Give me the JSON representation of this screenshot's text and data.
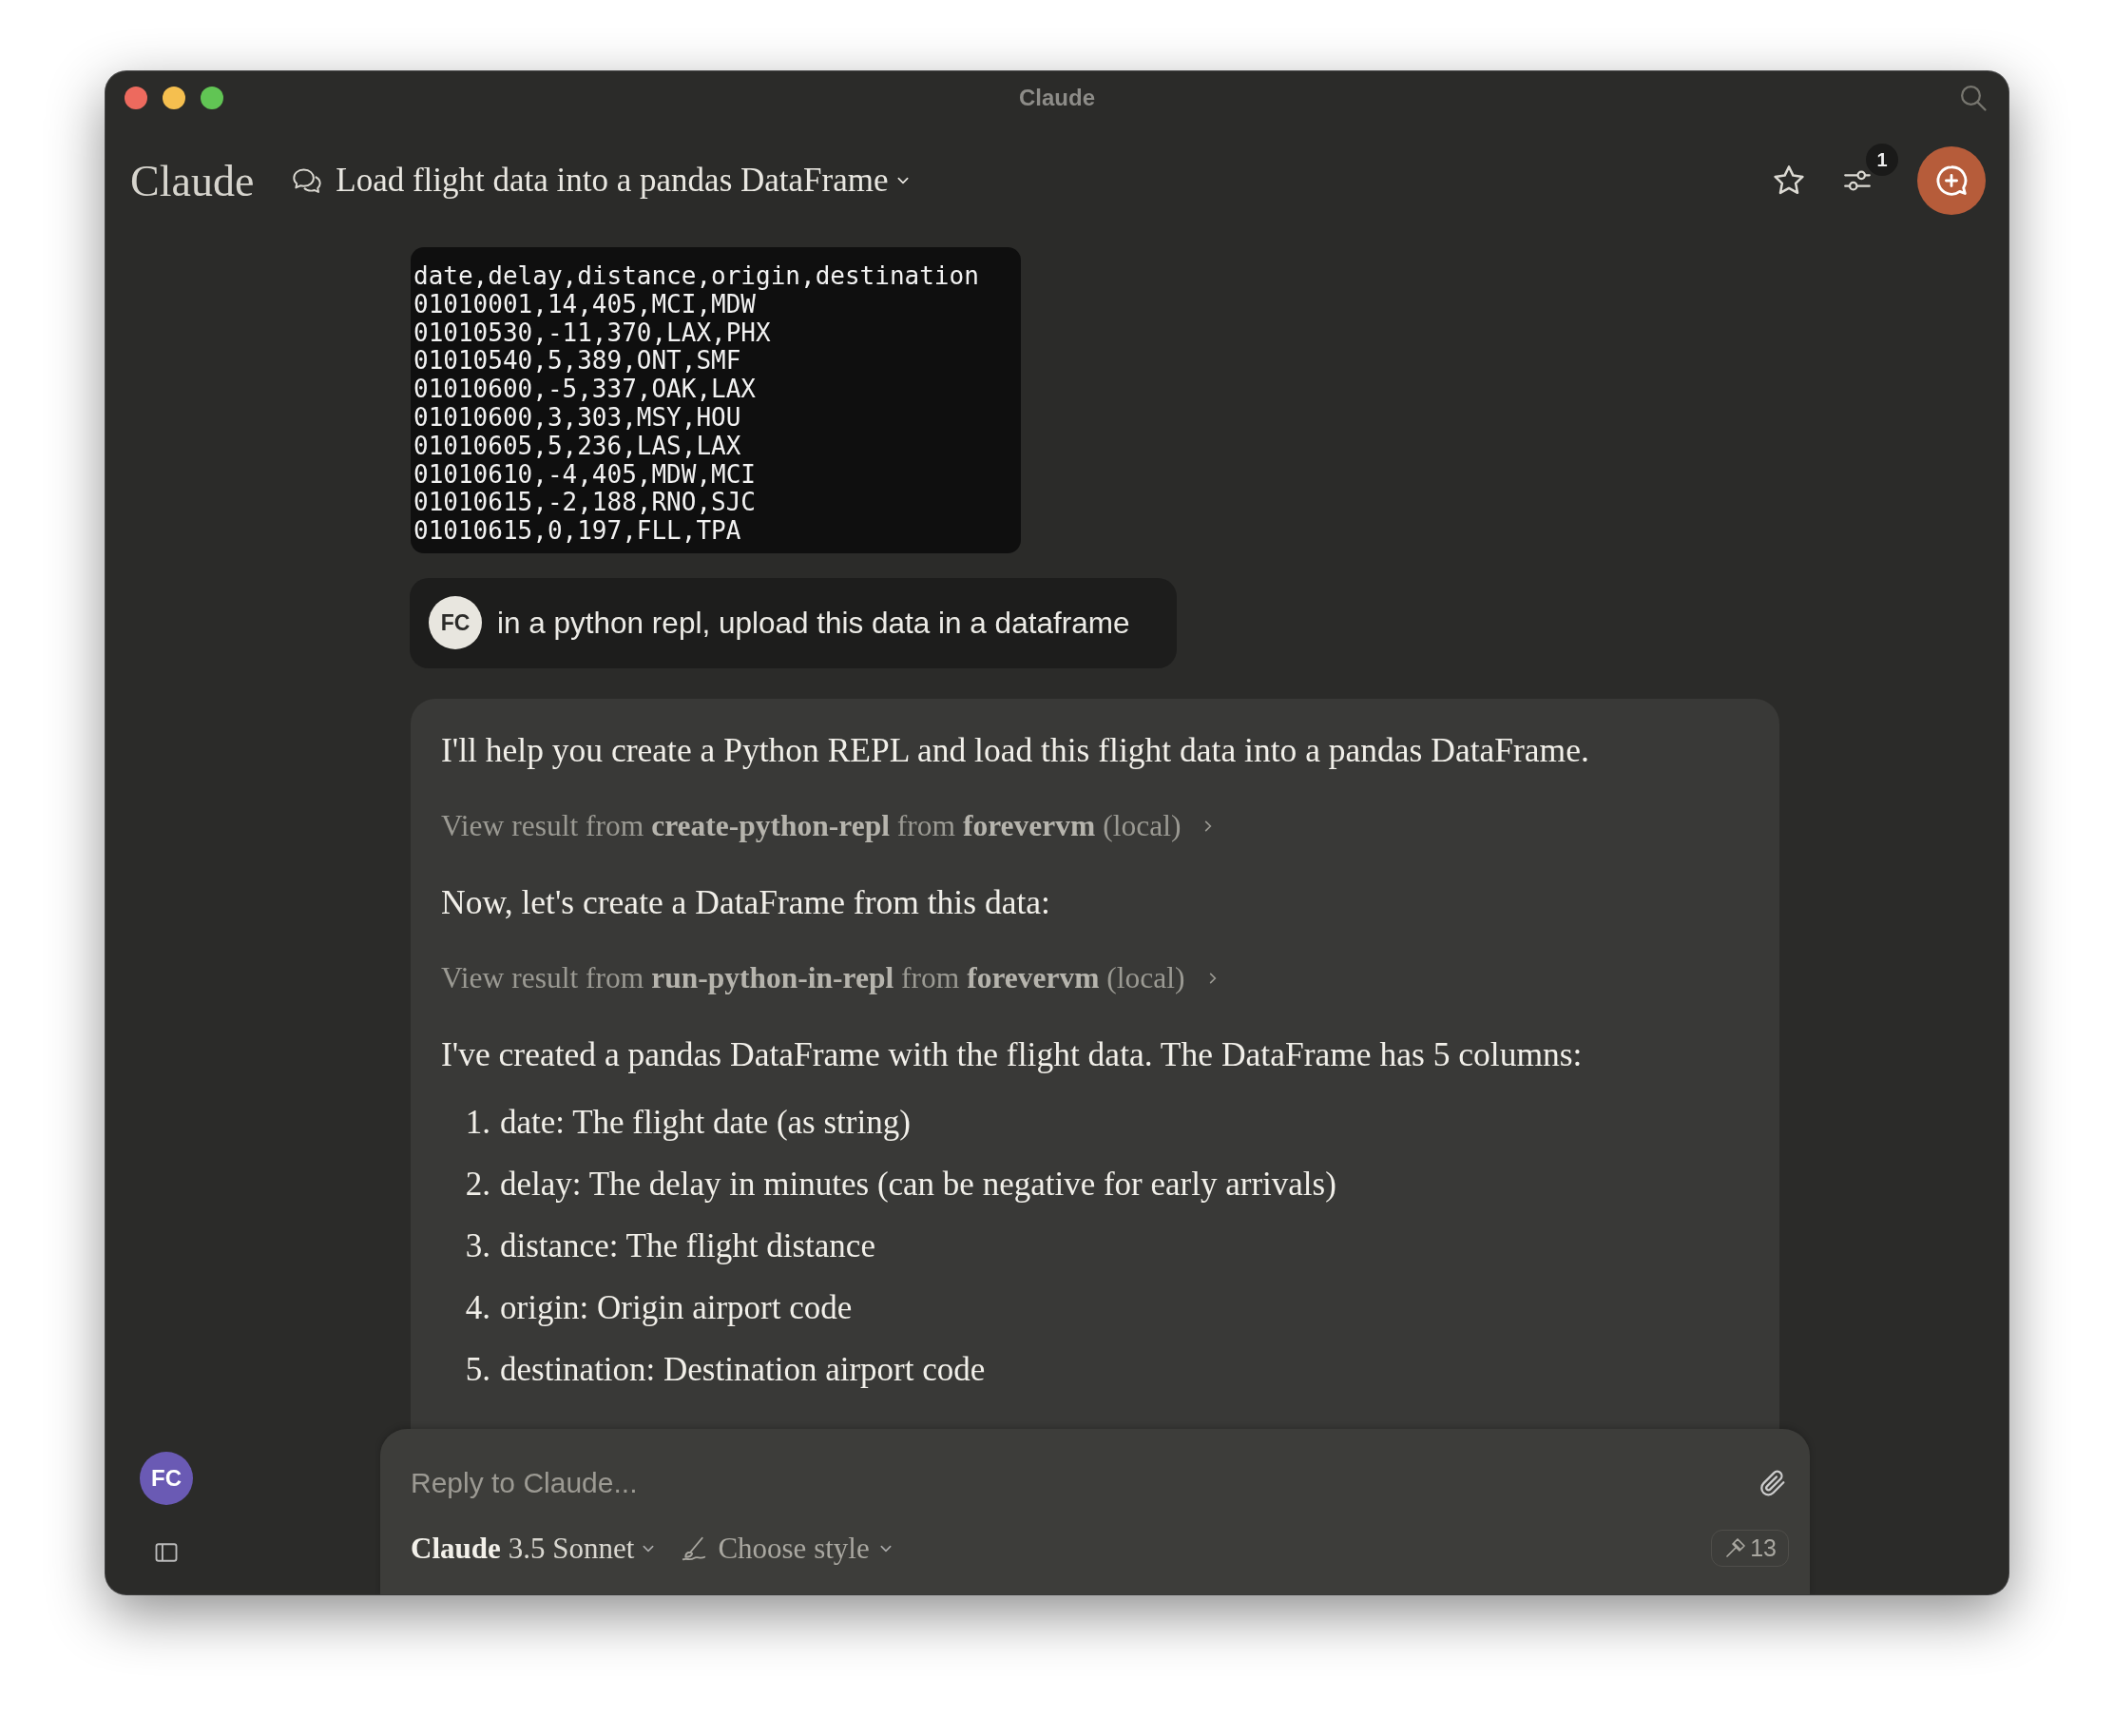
{
  "window": {
    "title": "Claude"
  },
  "header": {
    "logo": "Claude",
    "chat_title": "Load flight data into a pandas DataFrame",
    "notification_count": "1"
  },
  "messages": [
    {
      "kind": "code",
      "lines": [
        "date,delay,distance,origin,destination",
        "01010001,14,405,MCI,MDW",
        "01010530,-11,370,LAX,PHX",
        "01010540,5,389,ONT,SMF",
        "01010600,-5,337,OAK,LAX",
        "01010600,3,303,MSY,HOU",
        "01010605,5,236,LAS,LAX",
        "01010610,-4,405,MDW,MCI",
        "01010615,-2,188,RNO,SJC",
        "01010615,0,197,FLL,TPA"
      ]
    },
    {
      "kind": "user",
      "avatar": "FC",
      "text": "in a python repl, upload this data in a dataframe"
    },
    {
      "kind": "assistant",
      "blocks": [
        {
          "kind": "paragraph",
          "text": "I'll help you create a Python REPL and load this flight data into a pandas DataFrame."
        },
        {
          "kind": "tool_result",
          "text": "View result from **create-python-repl** from **forevervm** (local)"
        },
        {
          "kind": "paragraph",
          "text": "Now, let's create a DataFrame from this data:"
        },
        {
          "kind": "tool_result",
          "text": "View result from **run-python-in-repl** from **forevervm** (local)"
        },
        {
          "kind": "paragraph",
          "text": "I've created a pandas DataFrame with the flight data. The DataFrame has 5 columns:"
        },
        {
          "kind": "list",
          "items": [
            {
              "number": "1.",
              "text": "date: The flight date (as string)"
            },
            {
              "number": "2.",
              "text": "delay: The delay in minutes (can be negative for early arrivals)"
            },
            {
              "number": "3.",
              "text": "distance: The flight distance"
            },
            {
              "number": "4.",
              "text": "origin: Origin airport code"
            },
            {
              "number": "5.",
              "text": "destination: Destination airport code"
            }
          ]
        }
      ]
    }
  ],
  "sidebar": {
    "avatar": "FC"
  },
  "composer": {
    "placeholder": "Reply to Claude...",
    "model": {
      "name": "Claude",
      "version": "3.5 Sonnet"
    },
    "style": "Choose style",
    "tools_count": "13"
  }
}
